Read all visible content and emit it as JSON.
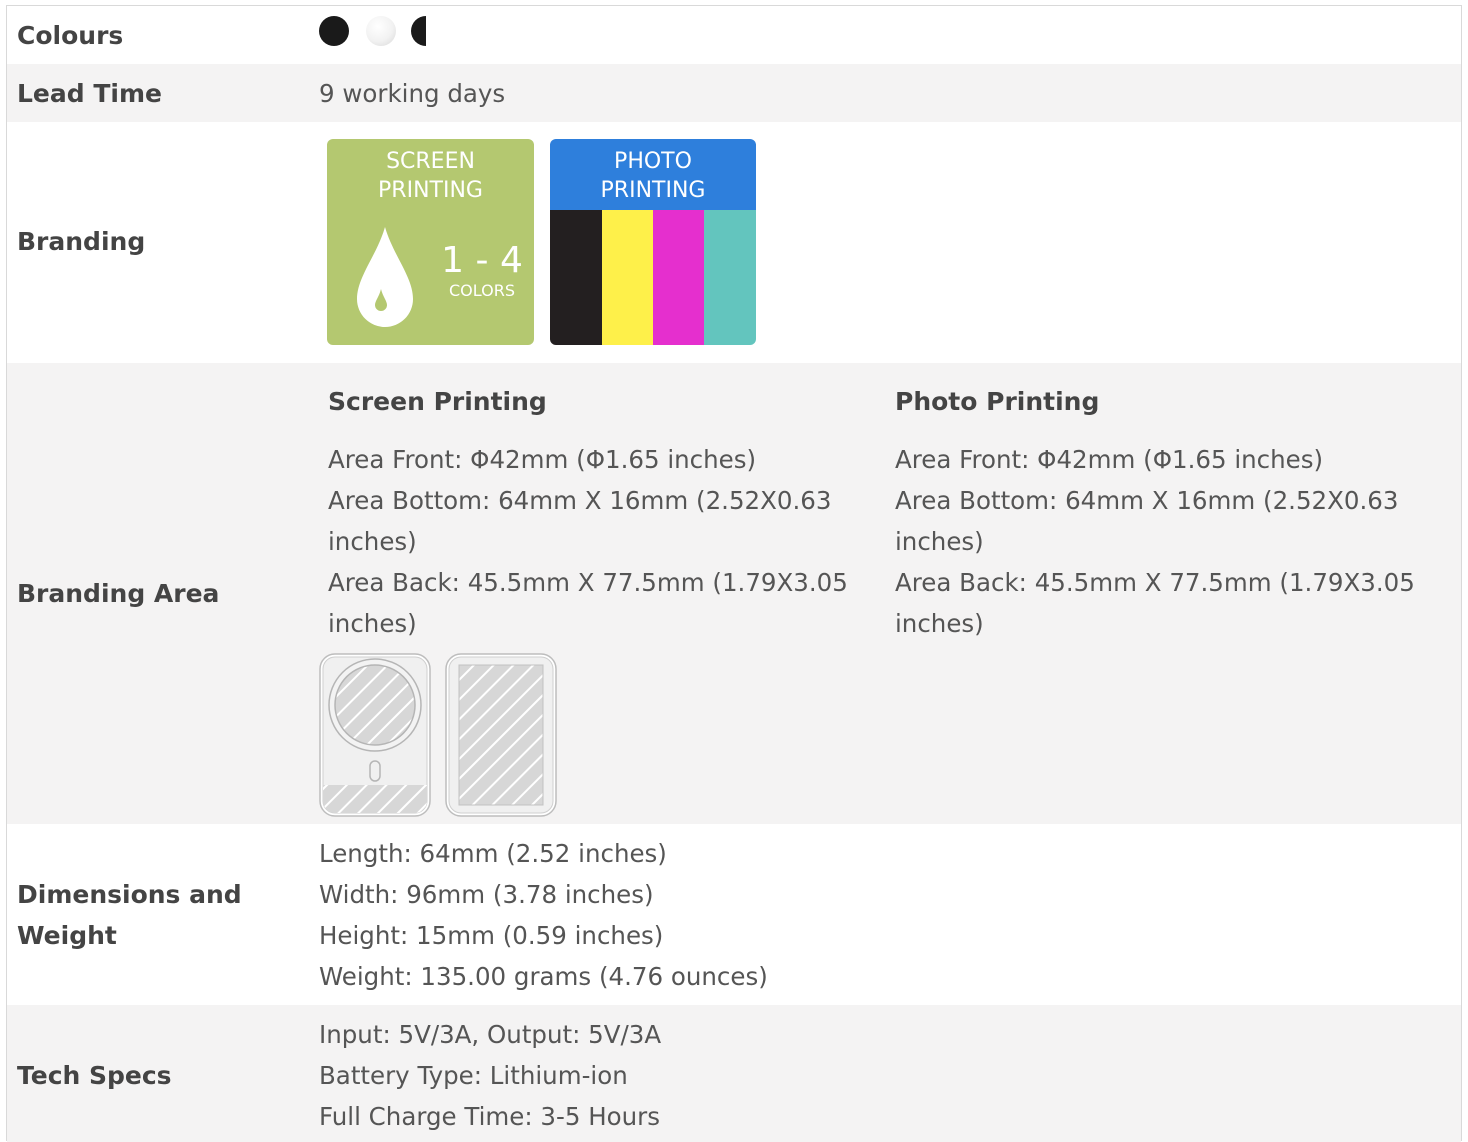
{
  "rows": {
    "colours": {
      "label": "Colours",
      "swatches": [
        "black",
        "white",
        "black-half"
      ]
    },
    "lead_time": {
      "label": "Lead Time",
      "value": "9 working days"
    },
    "branding": {
      "label": "Branding",
      "screen_tile": {
        "line1": "SCREEN",
        "line2": "PRINTING",
        "range": "1 - 4",
        "unit": "COLORS",
        "color": "#b4c870"
      },
      "photo_tile": {
        "line1": "PHOTO",
        "line2": "PRINTING",
        "header_color": "#2e7fdc",
        "stripes": [
          "#231f20",
          "#fef04a",
          "#e52fce",
          "#63c5be"
        ]
      }
    },
    "branding_area": {
      "label": "Branding Area",
      "screen": {
        "heading": "Screen Printing",
        "lines": [
          "Area Front: Φ42mm (Φ1.65 inches)",
          "Area Bottom: 64mm X 16mm (2.52X0.63",
          "inches)",
          "Area Back: 45.5mm X 77.5mm (1.79X3.05",
          "inches)"
        ]
      },
      "photo": {
        "heading": "Photo Printing",
        "lines": [
          "Area Front: Φ42mm (Φ1.65 inches)",
          "Area Bottom: 64mm X 16mm (2.52X0.63",
          "inches)",
          "Area Back: 45.5mm X 77.5mm (1.79X3.05",
          "inches)"
        ]
      }
    },
    "dimensions": {
      "label_line1": "Dimensions and",
      "label_line2": "Weight",
      "lines": [
        "Length: 64mm (2.52 inches)",
        "Width: 96mm (3.78 inches)",
        "Height: 15mm (0.59 inches)",
        "Weight: 135.00 grams (4.76 ounces)"
      ]
    },
    "tech_specs": {
      "label": "Tech Specs",
      "lines": [
        "Input: 5V/3A, Output: 5V/3A",
        "Battery Type: Lithium-ion",
        "Full Charge Time: 3-5 Hours"
      ]
    }
  }
}
